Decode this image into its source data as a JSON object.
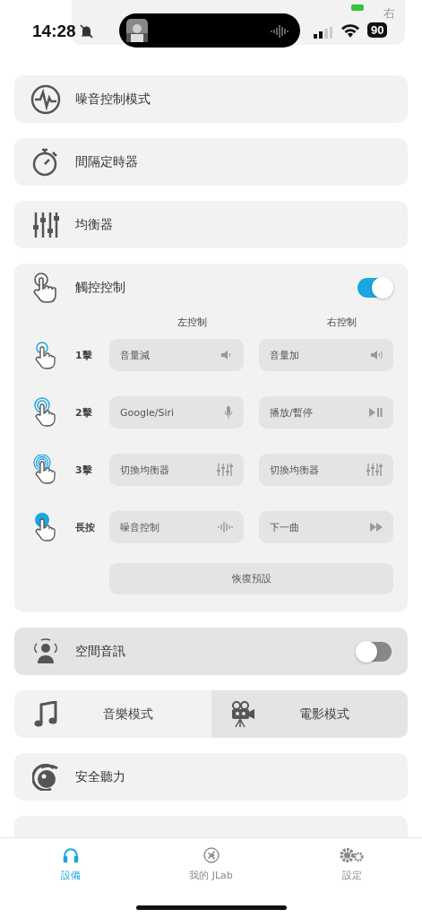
{
  "status_bar": {
    "time": "14:28",
    "silent": true,
    "battery": "90",
    "overlay_label": "右"
  },
  "menu": [
    {
      "kind": "noise",
      "label": "噪音控制模式"
    },
    {
      "kind": "timer",
      "label": "間隔定時器"
    },
    {
      "kind": "equalizer",
      "label": "均衡器"
    }
  ],
  "touch_controls": {
    "label": "觸控控制",
    "on": true,
    "columns": [
      "左控制",
      "右控制"
    ],
    "rows": [
      {
        "kind": "single",
        "label": "1擊",
        "left": {
          "label": "音量減",
          "kind": "volume-down"
        },
        "right": {
          "label": "音量加",
          "kind": "volume-up"
        }
      },
      {
        "kind": "double",
        "label": "2擊",
        "left": {
          "label": "Google/Siri",
          "kind": "mic"
        },
        "right": {
          "label": "播放/暫停",
          "kind": "play-pause"
        }
      },
      {
        "kind": "triple",
        "label": "3擊",
        "left": {
          "label": "切換均衡器",
          "kind": "equalizer"
        },
        "right": {
          "label": "切換均衡器",
          "kind": "equalizer"
        }
      },
      {
        "kind": "hold",
        "label": "長按",
        "left": {
          "label": "噪音控制",
          "kind": "noise"
        },
        "right": {
          "label": "下一曲",
          "kind": "next"
        }
      }
    ],
    "reset": "恢復預設"
  },
  "spatial_audio": {
    "label": "空間音訊",
    "on": false,
    "highlighted": true
  },
  "modes": [
    {
      "kind": "music",
      "label": "音樂模式",
      "selected": false
    },
    {
      "kind": "movie",
      "label": "電影模式",
      "selected": true
    }
  ],
  "safe_hearing": {
    "label": "安全聽力"
  },
  "tabs": [
    {
      "kind": "headphones",
      "label": "設備",
      "selected": true
    },
    {
      "kind": "logo",
      "label": "我的 JLab",
      "selected": false
    },
    {
      "kind": "gears",
      "label": "設定",
      "selected": false
    }
  ]
}
